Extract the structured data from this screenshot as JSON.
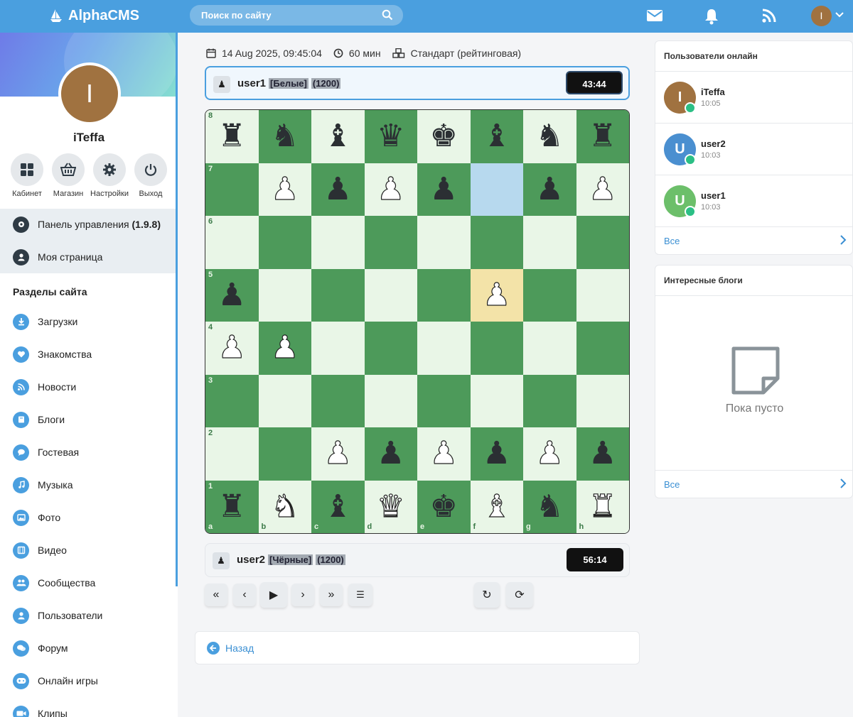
{
  "app": {
    "name": "AlphaCMS"
  },
  "search": {
    "placeholder": "Поиск по сайту"
  },
  "user": {
    "initial": "I",
    "name": "iTeffa"
  },
  "quick_actions": [
    {
      "label": "Кабинет",
      "icon": "grid-icon"
    },
    {
      "label": "Магазин",
      "icon": "basket-icon"
    },
    {
      "label": "Настройки",
      "icon": "gear-icon"
    },
    {
      "label": "Выход",
      "icon": "power-icon"
    }
  ],
  "panel": {
    "control_label": "Панель управления",
    "version": "(1.9.8)",
    "my_page": "Моя страница"
  },
  "sections": {
    "title": "Разделы сайта",
    "items": [
      "Загрузки",
      "Знакомства",
      "Новости",
      "Блоги",
      "Гостевая",
      "Музыка",
      "Фото",
      "Видео",
      "Сообщества",
      "Пользователи",
      "Форум",
      "Онлайн игры",
      "Клипы"
    ]
  },
  "game": {
    "date": "14 Aug 2025, 09:45:04",
    "duration": "60 мин",
    "mode": "Стандарт (рейтинговая)",
    "top_player": {
      "name": "user1",
      "color": "[Белые]",
      "rating": "(1200)",
      "clock": "43:44"
    },
    "bottom_player": {
      "name": "user2",
      "color": "[Чёрные]",
      "rating": "(1200)",
      "clock": "56:14"
    },
    "files": [
      "a",
      "b",
      "c",
      "d",
      "e",
      "f",
      "g",
      "h"
    ],
    "ranks": [
      "8",
      "7",
      "6",
      "5",
      "4",
      "3",
      "2",
      "1"
    ],
    "board": [
      [
        "bR",
        "bN",
        "bB",
        "bQ",
        "bK",
        "bB",
        "bN",
        "bR"
      ],
      [
        "",
        "wP",
        "bP",
        "wP",
        "bP",
        "",
        "bP",
        "wP"
      ],
      [
        "",
        "",
        "",
        "",
        "",
        "",
        "",
        ""
      ],
      [
        "bP",
        "",
        "",
        "",
        "",
        "wP",
        "",
        ""
      ],
      [
        "wP",
        "wP",
        "",
        "",
        "",
        "",
        "",
        ""
      ],
      [
        "",
        "",
        "",
        "",
        "",
        "",
        "",
        ""
      ],
      [
        "",
        "",
        "wP",
        "bP",
        "wP",
        "bP",
        "wP",
        "bP"
      ],
      [
        "bR",
        "wN",
        "bB",
        "wQ",
        "bK",
        "wB",
        "bN",
        "wR"
      ]
    ],
    "highlight_from": "f7",
    "highlight_to": "f5",
    "controls": [
      "«",
      "‹",
      "▶",
      "›",
      "»",
      "☰",
      "↻",
      "⟳"
    ]
  },
  "back": {
    "label": "Назад"
  },
  "online": {
    "title": "Пользователи онлайн",
    "users": [
      {
        "initial": "I",
        "name": "iTeffa",
        "time": "10:05",
        "color": "#a07240"
      },
      {
        "initial": "U",
        "name": "user2",
        "time": "10:03",
        "color": "#4a8fd0"
      },
      {
        "initial": "U",
        "name": "user1",
        "time": "10:03",
        "color": "#6cbf6a"
      }
    ],
    "all_label": "Все"
  },
  "blogs": {
    "title": "Интересные блоги",
    "empty_text": "Пока пусто",
    "all_label": "Все"
  }
}
